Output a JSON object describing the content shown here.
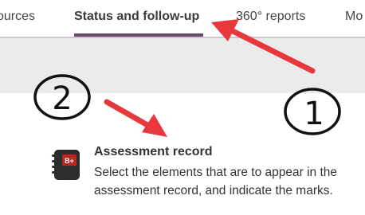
{
  "tabs": [
    {
      "label": "ources",
      "active": false
    },
    {
      "label": "Status and follow-up",
      "active": true
    },
    {
      "label": "360° reports",
      "active": false
    },
    {
      "label": "Mo",
      "active": false
    }
  ],
  "annotations": {
    "circle_1": "1",
    "circle_2": "2",
    "arrow_color": "#e8383b"
  },
  "tool": {
    "icon": "notebook-b-plus-icon",
    "icon_badge": "B+",
    "title": "Assessment record",
    "description": "Select the elements that are to appear in the assessment record, and indicate the marks."
  },
  "colors": {
    "active_tab_underline": "#6a4a6c",
    "grey_band": "#ecebeb",
    "icon_dark": "#2c2c2c",
    "icon_badge_red": "#c0261f"
  }
}
